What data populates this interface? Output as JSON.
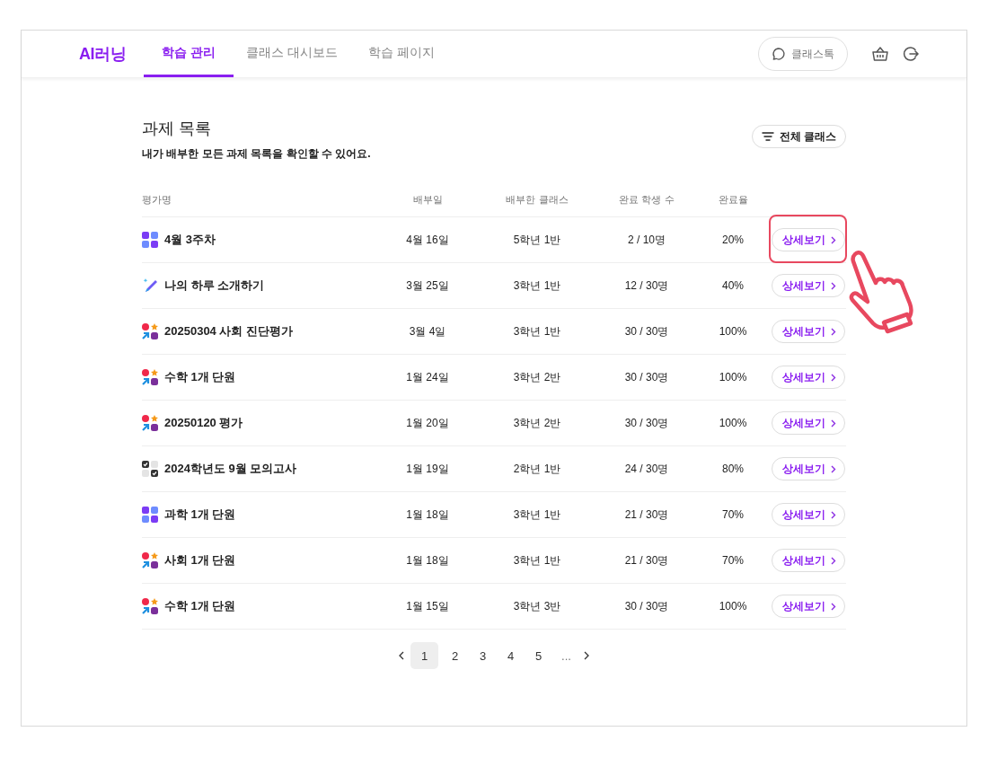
{
  "header": {
    "logo": "AI러닝",
    "tabs": [
      {
        "label": "학습 관리",
        "selected": true
      },
      {
        "label": "클래스 대시보드",
        "selected": false
      },
      {
        "label": "학습 페이지",
        "selected": false
      }
    ],
    "chat_button": "클래스톡"
  },
  "page": {
    "title": "과제 목록",
    "subtitle": "내가 배부한 모든 과제 목록을 확인할 수 있어요.",
    "filter_button": "전체 클래스"
  },
  "table": {
    "columns": [
      "평가명",
      "배부일",
      "배부한 클래스",
      "완료 학생 수",
      "완료율"
    ],
    "rows": [
      {
        "kind": "grid",
        "name": "4월 3주차",
        "date": "4월 16일",
        "class": "5학년 1반",
        "students": "2 / 10명",
        "rate": "20%",
        "action": "상세보기",
        "highlighted": true
      },
      {
        "kind": "brush",
        "name": "나의 하루 소개하기",
        "date": "3월 25일",
        "class": "3학년 1반",
        "students": "12 / 30명",
        "rate": "40%",
        "action": "상세보기",
        "highlighted": false
      },
      {
        "kind": "shapes",
        "name": "20250304 사회 진단평가",
        "date": "3월 4일",
        "class": "3학년 1반",
        "students": "30 / 30명",
        "rate": "100%",
        "action": "상세보기",
        "highlighted": false
      },
      {
        "kind": "shapes",
        "name": "수학 1개 단원",
        "date": "1월 24일",
        "class": "3학년 2반",
        "students": "30 / 30명",
        "rate": "100%",
        "action": "상세보기",
        "highlighted": false
      },
      {
        "kind": "shapes",
        "name": "20250120 평가",
        "date": "1월 20일",
        "class": "3학년 2반",
        "students": "30 / 30명",
        "rate": "100%",
        "action": "상세보기",
        "highlighted": false
      },
      {
        "kind": "check",
        "name": "2024학년도 9월 모의고사",
        "date": "1월 19일",
        "class": "2학년 1반",
        "students": "24 / 30명",
        "rate": "80%",
        "action": "상세보기",
        "highlighted": false
      },
      {
        "kind": "grid",
        "name": "과학 1개 단원",
        "date": "1월 18일",
        "class": "3학년 1반",
        "students": "21 / 30명",
        "rate": "70%",
        "action": "상세보기",
        "highlighted": false
      },
      {
        "kind": "shapes",
        "name": "사회 1개 단원",
        "date": "1월 18일",
        "class": "3학년 1반",
        "students": "21 / 30명",
        "rate": "70%",
        "action": "상세보기",
        "highlighted": false
      },
      {
        "kind": "shapes",
        "name": "수학 1개 단원",
        "date": "1월 15일",
        "class": "3학년 3반",
        "students": "30 / 30명",
        "rate": "100%",
        "action": "상세보기",
        "highlighted": false
      }
    ]
  },
  "pagination": {
    "pages": [
      {
        "label": "1",
        "selected": true
      },
      {
        "label": "2",
        "selected": false
      },
      {
        "label": "3",
        "selected": false
      },
      {
        "label": "4",
        "selected": false
      },
      {
        "label": "5",
        "selected": false
      }
    ],
    "ellipsis": "..."
  }
}
